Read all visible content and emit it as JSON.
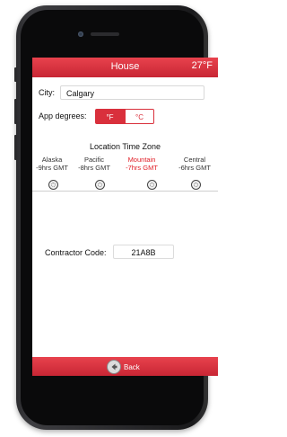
{
  "header": {
    "title": "House",
    "temperature": "27°F"
  },
  "city": {
    "label": "City:",
    "value": "Calgary"
  },
  "degrees": {
    "label": "App degrees:",
    "options": [
      "°F",
      "°C"
    ],
    "selected": "°F"
  },
  "timezone": {
    "heading": "Location Time Zone",
    "options": [
      {
        "name": "Alaska",
        "offset": "-9hrs GMT"
      },
      {
        "name": "Pacific",
        "offset": "-8hrs GMT"
      },
      {
        "name": "Mountain",
        "offset": "-7hrs GMT"
      },
      {
        "name": "Central",
        "offset": "-6hrs GMT"
      }
    ],
    "selected": "Mountain"
  },
  "contractor": {
    "label": "Contractor Code:",
    "value": "21A8B"
  },
  "footer": {
    "back_label": "Back"
  },
  "colors": {
    "accent": "#d9303c",
    "selected_text": "#e01b24"
  }
}
